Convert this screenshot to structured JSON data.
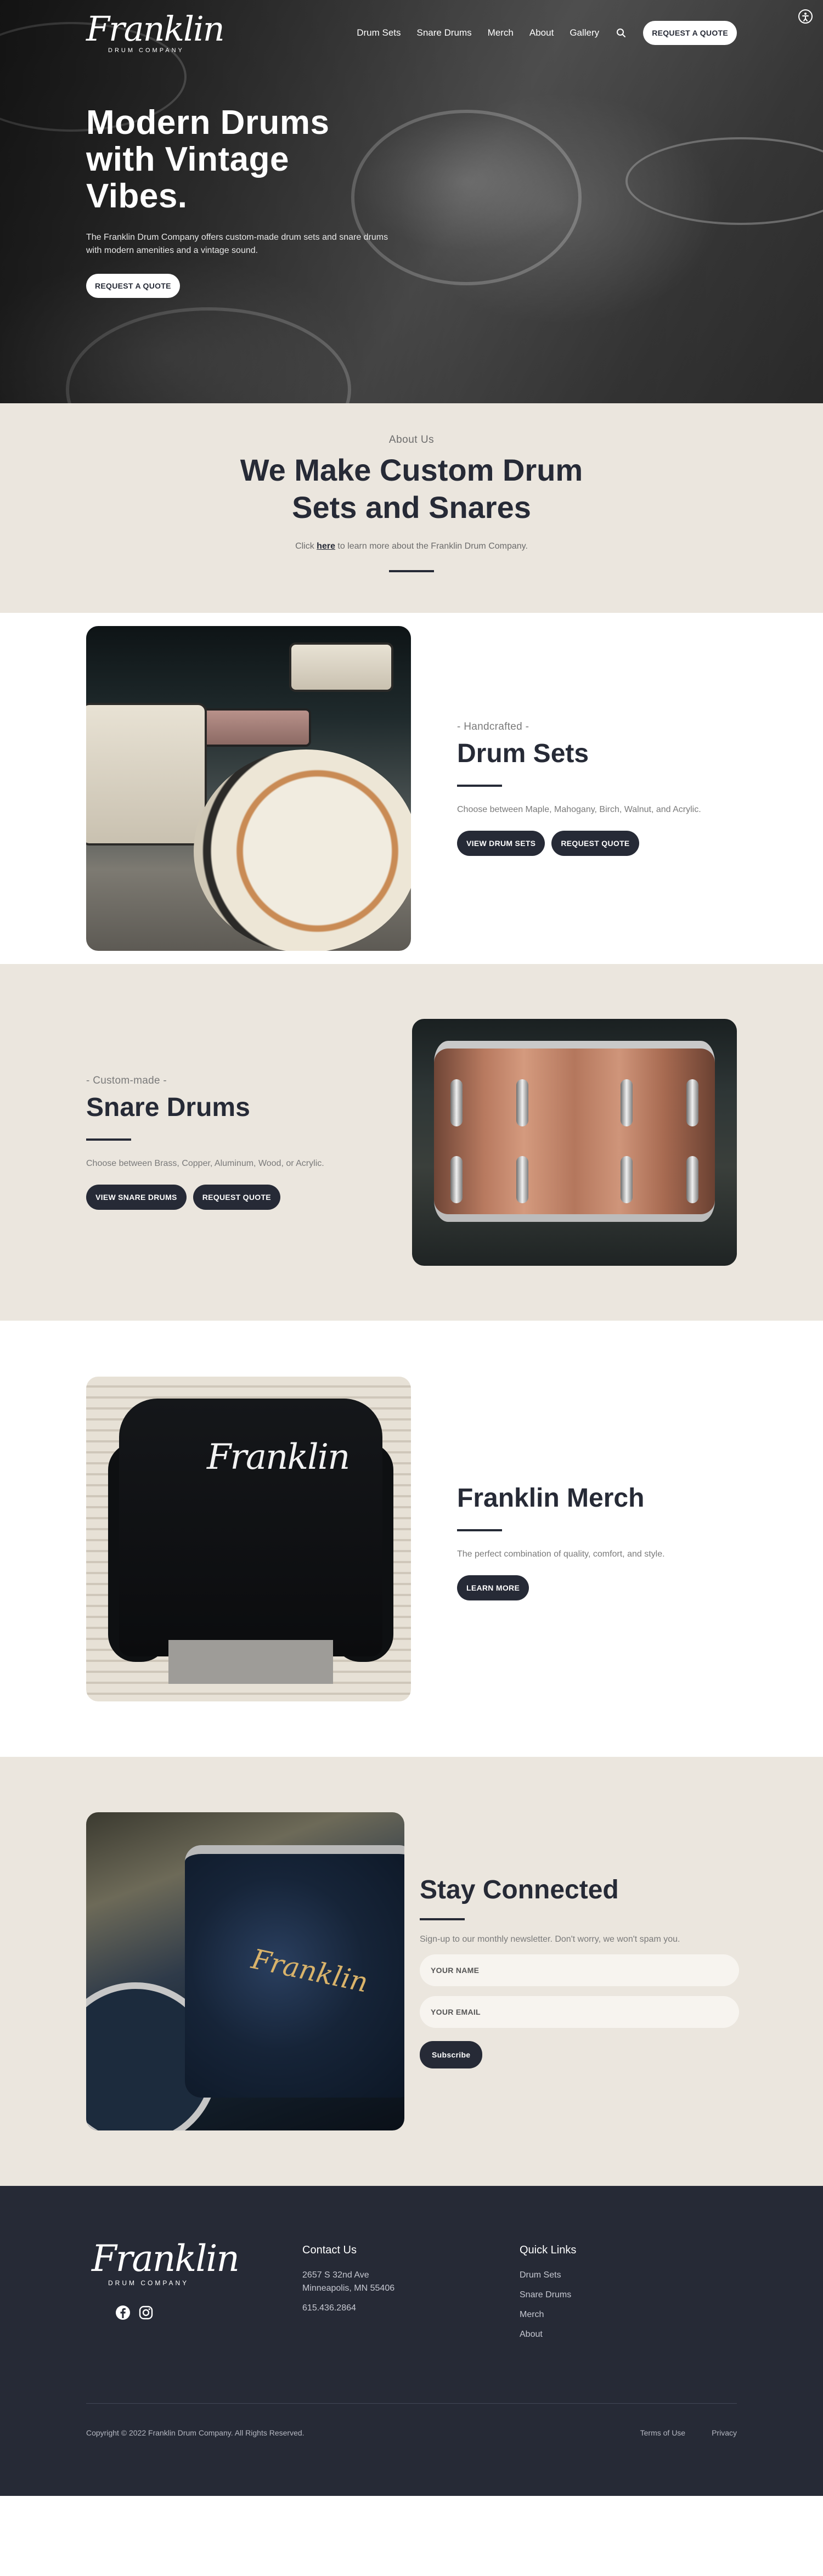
{
  "brand": {
    "logo_script": "Franklin",
    "logo_sub": "DRUM COMPANY"
  },
  "nav": {
    "items": [
      {
        "label": "Drum Sets"
      },
      {
        "label": "Snare Drums"
      },
      {
        "label": "Merch"
      },
      {
        "label": "About"
      },
      {
        "label": "Gallery"
      }
    ],
    "search_icon": "search-icon",
    "cta": "REQUEST A QUOTE"
  },
  "hero": {
    "title": "Modern Drums with Vintage Vibes.",
    "description": "The Franklin Drum Company offers custom-made drum sets and snare drums with modern amenities and a vintage sound.",
    "cta": "REQUEST A QUOTE"
  },
  "about": {
    "eyebrow": "About Us",
    "title": "We Make Custom Drum Sets and Snares",
    "note_before": "Click ",
    "note_link": "here",
    "note_after": " to learn more about the Franklin Drum Company."
  },
  "drum_sets": {
    "eyebrow": "- Handcrafted -",
    "title": "Drum Sets",
    "description": "Choose between Maple, Mahogany, Birch, Walnut, and Acrylic.",
    "primary": "VIEW DRUM SETS",
    "secondary": "REQUEST QUOTE"
  },
  "snare_drums": {
    "eyebrow": "- Custom-made -",
    "title": "Snare Drums",
    "description": "Choose between Brass, Copper, Aluminum, Wood, or Acrylic.",
    "primary": "VIEW SNARE DRUMS",
    "secondary": "REQUEST QUOTE"
  },
  "merch": {
    "title": "Franklin Merch",
    "description": "The perfect combination of quality, comfort, and style.",
    "primary": "LEARN MORE",
    "shirt_script": "Franklin"
  },
  "newsletter": {
    "title": "Stay Connected",
    "description": "Sign-up to our monthly newsletter. Don't worry, we won't spam you.",
    "name_placeholder": "YOUR NAME",
    "email_placeholder": "YOUR EMAIL",
    "submit": "Subscribe",
    "drum_script": "Franklin"
  },
  "footer": {
    "contact_heading": "Contact Us",
    "address_line1": "2657 S 32nd Ave",
    "address_line2": "Minneapolis, MN 55406",
    "phone": "615.436.2864",
    "links_heading": "Quick Links",
    "links": [
      {
        "label": "Drum Sets"
      },
      {
        "label": "Snare Drums"
      },
      {
        "label": "Merch"
      },
      {
        "label": "About"
      }
    ],
    "copyright": "Copyright © 2022 Franklin Drum Company. All Rights Reserved.",
    "terms": "Terms of Use",
    "privacy": "Privacy",
    "social": [
      "facebook-icon",
      "instagram-icon"
    ]
  },
  "colors": {
    "navy": "#262a36",
    "beige": "#ebe6de",
    "white": "#ffffff"
  }
}
